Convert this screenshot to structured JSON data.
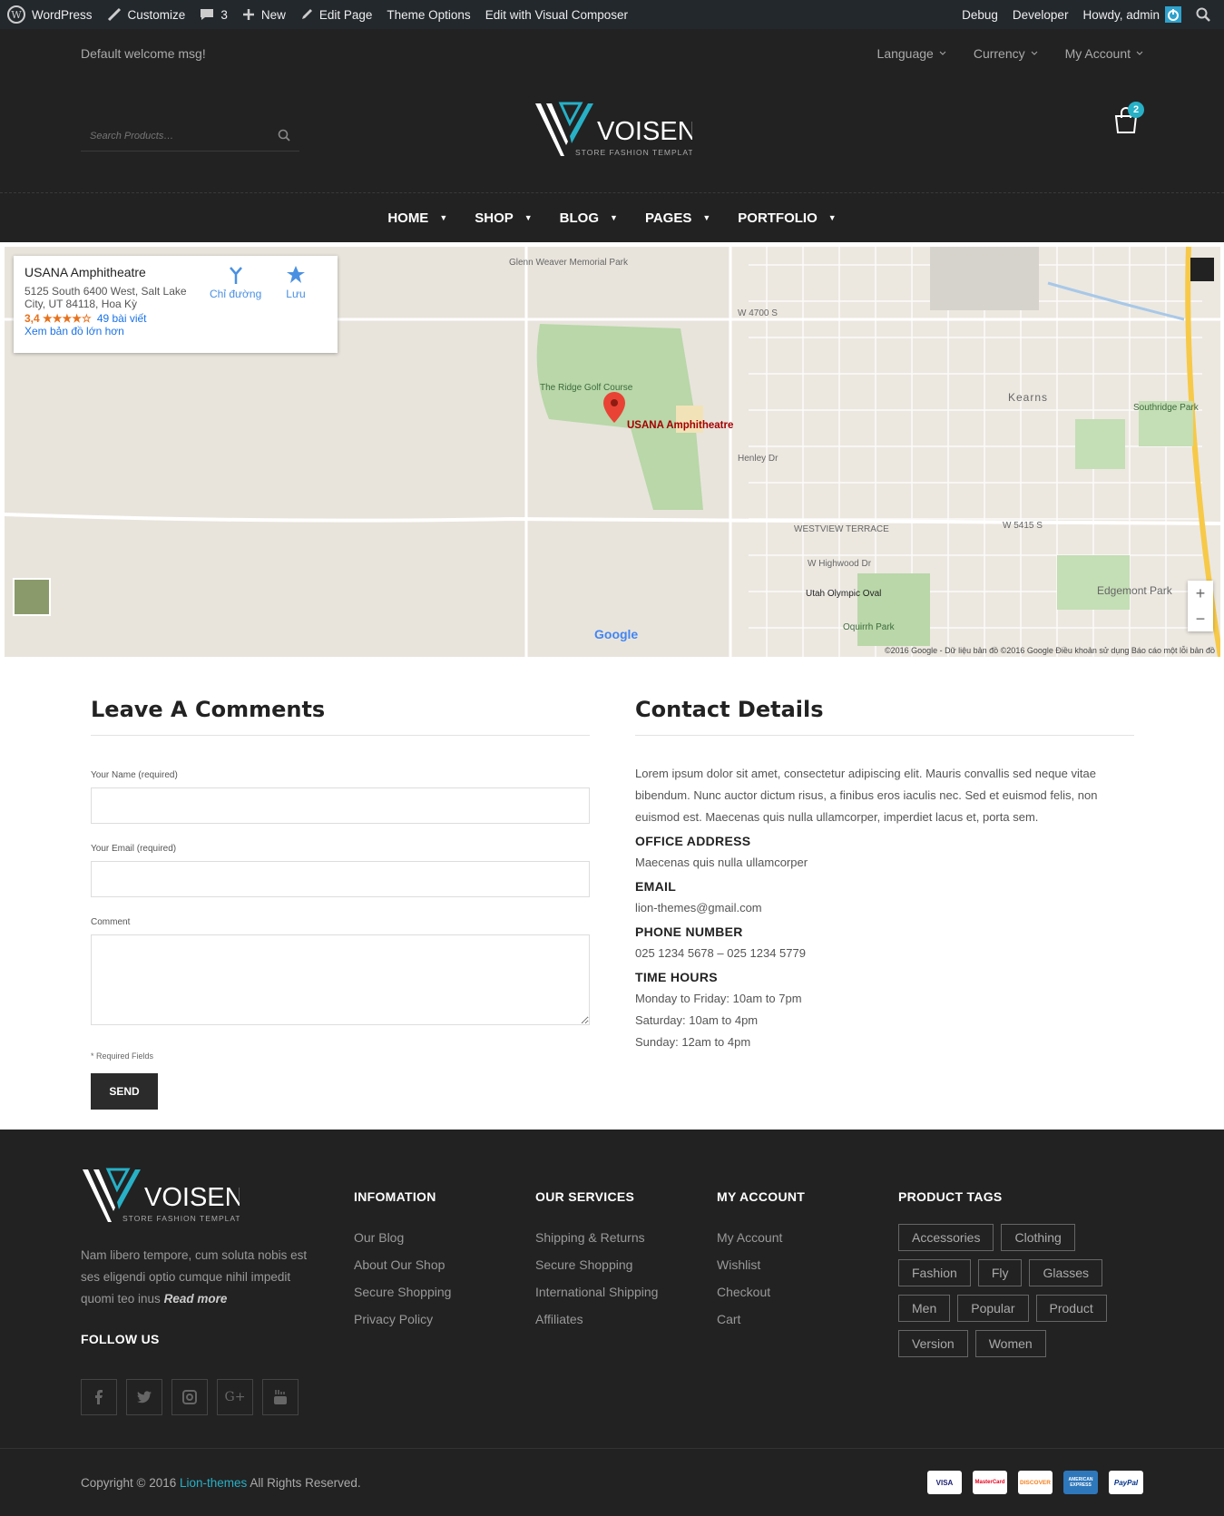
{
  "adminbar": {
    "wordpress": "WordPress",
    "customize": "Customize",
    "comments": "3",
    "new": "New",
    "edit_page": "Edit Page",
    "theme_options": "Theme Options",
    "visual_composer": "Edit with Visual Composer",
    "debug": "Debug",
    "developer": "Developer",
    "howdy": "Howdy, admin"
  },
  "topbar": {
    "welcome": "Default welcome msg!",
    "language": "Language",
    "currency": "Currency",
    "account": "My Account"
  },
  "header": {
    "search_placeholder": "Search Products…",
    "logo_name": "VOISEN",
    "logo_tagline": "STORE FASHION TEMPLATE",
    "cart_count": "2"
  },
  "nav": [
    "HOME",
    "SHOP",
    "BLOG",
    "PAGES",
    "PORTFOLIO"
  ],
  "map": {
    "place": "USANA Amphitheatre",
    "address": "5125 South 6400 West, Salt Lake City, UT 84118, Hoa Kỳ",
    "rating": "3,4 ★★★★☆",
    "reviews": "49 bài viết",
    "larger": "Xem bản đồ lớn hơn",
    "directions": "Chỉ đường",
    "save": "Lưu",
    "pin_label": "USANA Amphitheatre",
    "copyright": "©2016 Google - Dữ liệu bản đồ ©2016 Google   Điều khoản sử dụng   Báo cáo một lỗi bản đồ",
    "labels": [
      "Glenn Weaver Memorial Park",
      "The Ridge Golf Course",
      "Kearns",
      "Southridge Park",
      "Edgemont Park",
      "Utah Olympic Oval",
      "Oquirrh Park",
      "WESTVIEW TERRACE",
      "W 4700 S",
      "W 5415 S",
      "Henley Dr",
      "W Highwood Dr",
      "Google"
    ]
  },
  "comments": {
    "title": "Leave A Comments",
    "name_label": "Your Name (required)",
    "email_label": "Your Email (required)",
    "comment_label": "Comment",
    "required_note": "* Required Fields",
    "send": "SEND"
  },
  "contact": {
    "title": "Contact Details",
    "intro": "Lorem ipsum dolor sit amet, consectetur adipiscing elit. Mauris convallis sed neque vitae bibendum. Nunc auctor dictum risus, a finibus eros iaculis nec. Sed et euismod felis, non euismod est. Maecenas quis nulla ullamcorper, imperdiet lacus et, porta sem.",
    "office_h": "OFFICE ADDRESS",
    "office": "Maecenas quis nulla ullamcorper",
    "email_h": "EMAIL",
    "email": "lion-themes@gmail.com",
    "phone_h": "PHONE NUMBER",
    "phone": "025 1234 5678 – 025 1234 5779",
    "hours_h": "TIME HOURS",
    "hours1": "Monday to Friday: 10am to 7pm",
    "hours2": "Saturday: 10am to 4pm",
    "hours3": "Sunday: 12am to 4pm"
  },
  "footer": {
    "about_text": "Nam libero tempore, cum soluta nobis est ses eligendi optio cumque nihil impedit quomi teo inus",
    "read_more": "Read more",
    "follow": "FOLLOW US",
    "info": {
      "title": "INFOMATION",
      "links": [
        "Our Blog",
        "About Our Shop",
        "Secure Shopping",
        "Privacy Policy"
      ]
    },
    "services": {
      "title": "OUR SERVICES",
      "links": [
        "Shipping & Returns",
        "Secure Shopping",
        "International Shipping",
        "Affiliates"
      ]
    },
    "account": {
      "title": "MY ACCOUNT",
      "links": [
        "My Account",
        "Wishlist",
        "Checkout",
        "Cart"
      ]
    },
    "tags": {
      "title": "PRODUCT TAGS",
      "items": [
        "Accessories",
        "Clothing",
        "Fashion",
        "Fly",
        "Glasses",
        "Men",
        "Popular",
        "Product",
        "Version",
        "Women"
      ]
    },
    "copyright_pre": "Copyright © 2016 ",
    "copyright_brand": "Lion-themes",
    "copyright_post": " All Rights Reserved.",
    "cards": [
      "VISA",
      "MasterCard",
      "DISCOVER",
      "AMERICAN EXPRESS",
      "PayPal"
    ]
  }
}
